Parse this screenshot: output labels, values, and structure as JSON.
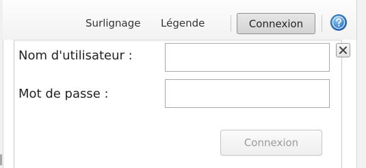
{
  "toolbar": {
    "highlight_label": "Surlignage",
    "legend_label": "Légende",
    "connect_label": "Connexion",
    "help_icon": "help-icon"
  },
  "login": {
    "username_label": "Nom d'utilisateur :",
    "username_value": "",
    "password_label": "Mot de passe :",
    "password_value": "",
    "close_icon": "close-icon",
    "submit_label": "Connexion"
  },
  "colors": {
    "help_icon_blue": "#2f7fd6",
    "disabled_text": "#9a9a9a",
    "border": "#a9a9a9"
  }
}
